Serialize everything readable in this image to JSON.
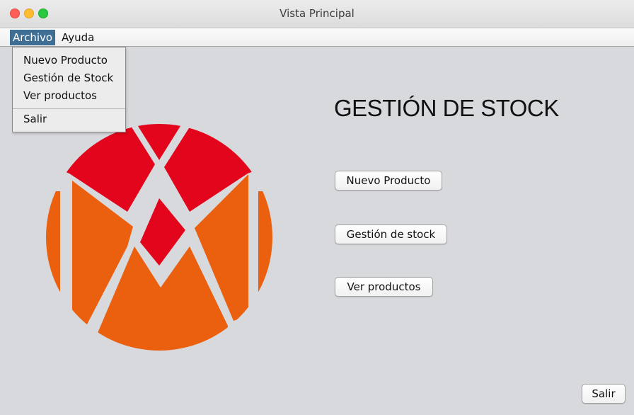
{
  "window": {
    "title": "Vista Principal"
  },
  "menubar": {
    "archivo": "Archivo",
    "ayuda": "Ayuda"
  },
  "dropdown": {
    "items": [
      "Nuevo Producto",
      "Gestión de Stock",
      "Ver productos"
    ],
    "exit": "Salir"
  },
  "main": {
    "heading": "GESTIÓN DE STOCK",
    "btn_nuevo": "Nuevo Producto",
    "btn_gestion": "Gestión de stock",
    "btn_ver": "Ver productos",
    "btn_salir": "Salir"
  },
  "colors": {
    "logo_red": "#e2051b",
    "logo_orange": "#ea600f",
    "menu_active": "#3f6e95",
    "background": "#d8d9dc"
  },
  "icons": {
    "logo": "red-orange-circle-logo",
    "window_controls": [
      "close-icon",
      "minimize-icon",
      "zoom-icon"
    ]
  }
}
